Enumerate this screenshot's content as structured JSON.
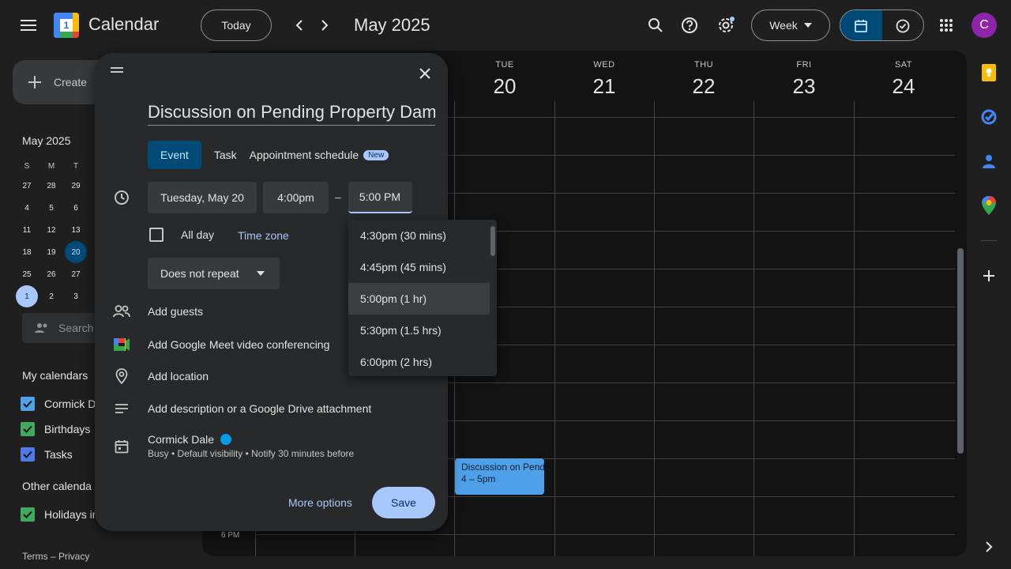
{
  "header": {
    "app_title": "Calendar",
    "logo_num": "1",
    "today": "Today",
    "month": "May 2025",
    "view": "Week",
    "avatar": "C"
  },
  "sidebar": {
    "create": "Create",
    "mini_month": "May 2025",
    "weekdays": [
      "S",
      "M",
      "T"
    ],
    "weeks": [
      [
        "27",
        "28",
        "29"
      ],
      [
        "4",
        "5",
        "6"
      ],
      [
        "11",
        "12",
        "13"
      ],
      [
        "18",
        "19",
        "20"
      ],
      [
        "25",
        "26",
        "27"
      ],
      [
        "1",
        "2",
        "3"
      ]
    ],
    "search_people": "Search",
    "my_calendars": "My calendars",
    "calendars": [
      {
        "label": "Cormick D",
        "color": "#4ea0e8"
      },
      {
        "label": "Birthdays",
        "color": "#41a85f"
      },
      {
        "label": "Tasks",
        "color": "#4e7ae8"
      }
    ],
    "other_calendars": "Other calenda",
    "other": [
      {
        "label": "Holidays in",
        "color": "#41a85f"
      }
    ],
    "footer": "Terms – Privacy"
  },
  "grid": {
    "days": [
      {
        "dow": "TUE",
        "num": "20"
      },
      {
        "dow": "WED",
        "num": "21"
      },
      {
        "dow": "THU",
        "num": "22"
      },
      {
        "dow": "FRI",
        "num": "23"
      },
      {
        "dow": "SAT",
        "num": "24"
      }
    ],
    "time_label": "6 PM",
    "event": {
      "title": "Discussion on Pending",
      "time": "4 – 5pm",
      "color": "#4ea0e8"
    }
  },
  "dialog": {
    "title": "Discussion on Pending Property Damage",
    "tabs": {
      "event": "Event",
      "task": "Task",
      "appointment": "Appointment schedule",
      "new_badge": "New"
    },
    "date": "Tuesday, May 20",
    "start": "4:00pm",
    "dash": "–",
    "end": "5:00 PM",
    "all_day": "All day",
    "time_zone": "Time zone",
    "repeat": "Does not repeat",
    "add_guests": "Add guests",
    "add_meet": "Add Google Meet video conferencing",
    "add_location": "Add location",
    "add_description": "Add description or a Google Drive attachment",
    "owner": "Cormick Dale",
    "owner_details": "Busy • Default visibility • Notify 30 minutes before",
    "more_options": "More options",
    "save": "Save"
  },
  "dropdown": {
    "options": [
      "4:30pm (30 mins)",
      "4:45pm (45 mins)",
      "5:00pm (1 hr)",
      "5:30pm (1.5 hrs)",
      "6:00pm (2 hrs)"
    ],
    "selected": "5:00pm (1 hr)"
  }
}
